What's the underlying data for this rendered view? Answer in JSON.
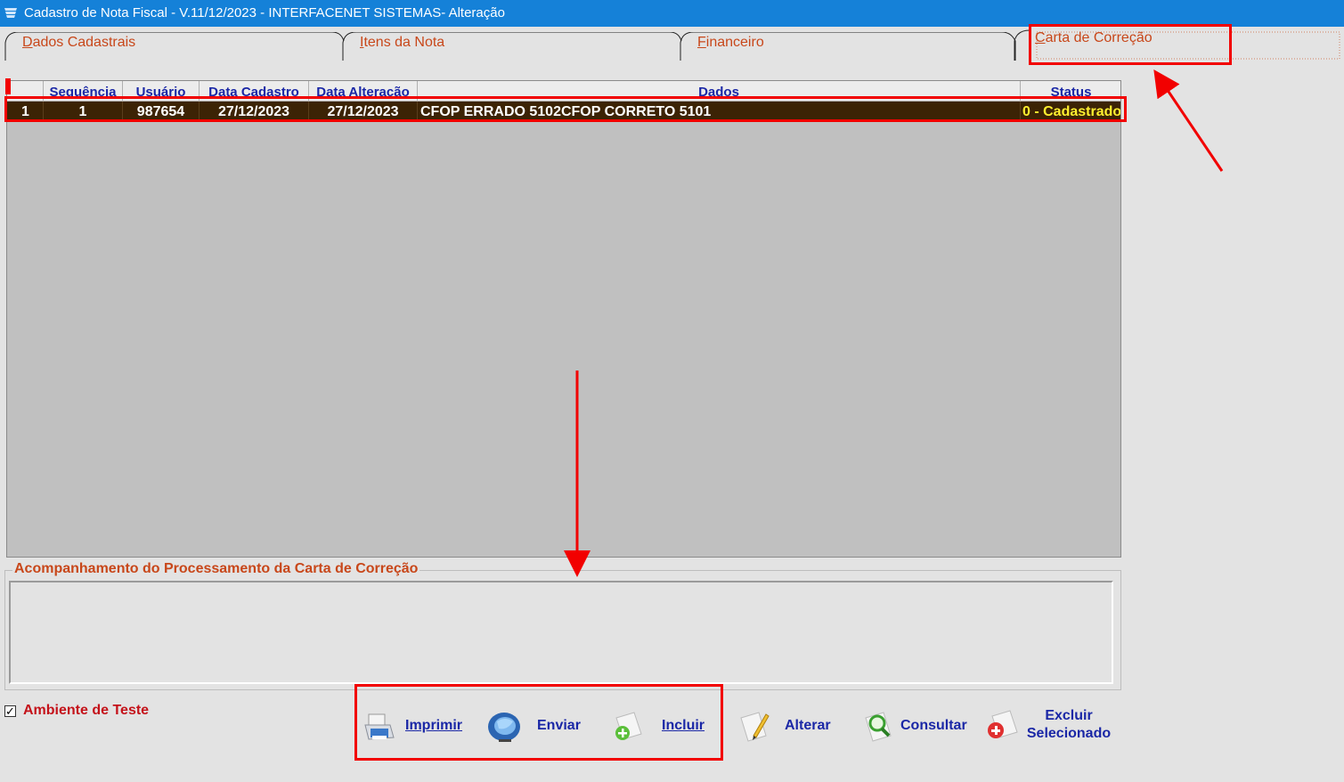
{
  "window": {
    "title": "Cadastro de Nota Fiscal - V.11/12/2023 - INTERFACENET SISTEMAS- Alteração"
  },
  "tabs": [
    {
      "label": "Dados Cadastrais"
    },
    {
      "label": "Itens da Nota"
    },
    {
      "label": "Financeiro"
    },
    {
      "label": "Carta de Correção",
      "active": true
    }
  ],
  "grid": {
    "columns": [
      "",
      "Sequência",
      "Usuário",
      "Data Cadastro",
      "Data Alteração",
      "Dados",
      "Status"
    ],
    "rows": [
      [
        "1",
        "1",
        "987654",
        "27/12/2023",
        "27/12/2023",
        "CFOP ERRADO 5102CFOP CORRETO 5101",
        "0 - Cadastrado"
      ]
    ]
  },
  "processing": {
    "label": "Acompanhamento do Processamento da Carta de Correção",
    "log": ""
  },
  "test_env": {
    "label": "Ambiente de Teste",
    "checked": true
  },
  "buttons": {
    "print": "Imprimir",
    "send": "Enviar",
    "add": "Incluir",
    "edit": "Alterar",
    "query": "Consultar",
    "delete_line1": "Excluir",
    "delete_line2": "Selecionado"
  },
  "colors": {
    "titlebar": "#1581d8",
    "tab_text": "#c8471a",
    "header_text": "#1a27a6",
    "selected_row": "#3c2305",
    "status_text": "#ffef2f",
    "annotation": "#f20000"
  }
}
